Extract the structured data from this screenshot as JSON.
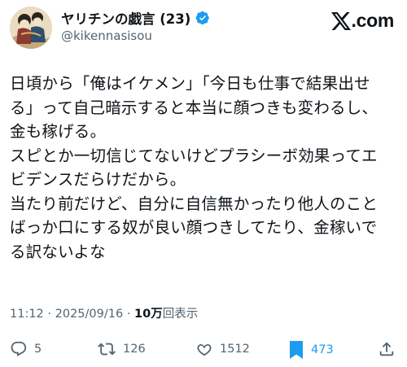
{
  "author": {
    "display_name": "ヤリチンの戯言 (23)",
    "handle": "@kikennasisou",
    "verified": true
  },
  "brand": {
    "logo_text": ".com",
    "logo_icon": "x-logo-icon"
  },
  "tweet": {
    "lines": [
      "日頃から「俺はイケメン」「今日も仕事で結果出せ",
      "る」って自己暗示すると本当に顔つきも変わるし、",
      "金も稼げる。",
      "スピとか一切信じてないけどプラシーボ効果ってエ",
      "ビデンスだらけだから。",
      "当たり前だけど、自分に自信無かったり他人のこと",
      "ばっか口にする奴が良い顔つきしてたり、金稼いで",
      "る訳ないよな"
    ]
  },
  "meta": {
    "time": "11:12",
    "separator": "·",
    "date": "2025/09/16",
    "views_count": "10万",
    "views_label": "回表示"
  },
  "actions": {
    "reply": {
      "icon": "reply-icon",
      "count": "5"
    },
    "retweet": {
      "icon": "retweet-icon",
      "count": "126"
    },
    "like": {
      "icon": "heart-icon",
      "count": "1512"
    },
    "bookmark": {
      "icon": "bookmark-icon",
      "count": "473",
      "active": true
    },
    "share": {
      "icon": "share-icon"
    }
  },
  "colors": {
    "text": "#0f1419",
    "secondary": "#536471",
    "accent": "#1d9bf0"
  }
}
